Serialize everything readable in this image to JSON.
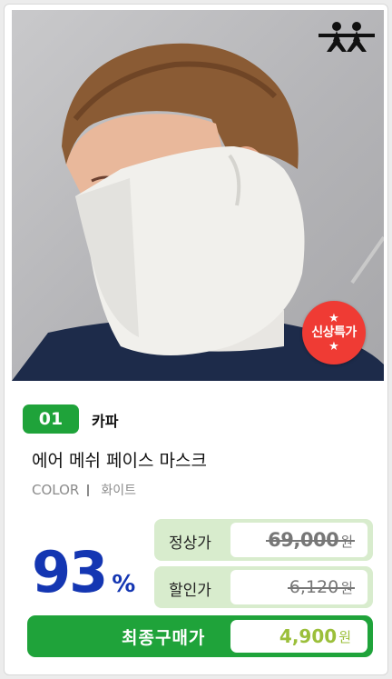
{
  "product": {
    "badge": {
      "star_top": "★",
      "label": "신상특가",
      "star_bottom": "★"
    },
    "rank": "01",
    "brand": "카파",
    "title": "에어 메쉬 페이스 마스크",
    "color_label": "COLOR",
    "color_value": "화이트",
    "discount_value": "93",
    "discount_unit": "%",
    "original_price": {
      "label": "정상가",
      "value": "69,000",
      "unit": "원"
    },
    "discount_price": {
      "label": "할인가",
      "value": "6,120",
      "unit": "원"
    },
    "final_price": {
      "label": "최종구매가",
      "value": "4,900",
      "unit": "원"
    }
  },
  "colors": {
    "green": "#1fa33a",
    "light_green": "#d8eccd",
    "blue": "#1436b2",
    "red": "#ef3b34",
    "final_text": "#9bbf3a"
  },
  "icons": {
    "brand_logo": "kappa-logo-icon",
    "photo": "product-photo"
  }
}
